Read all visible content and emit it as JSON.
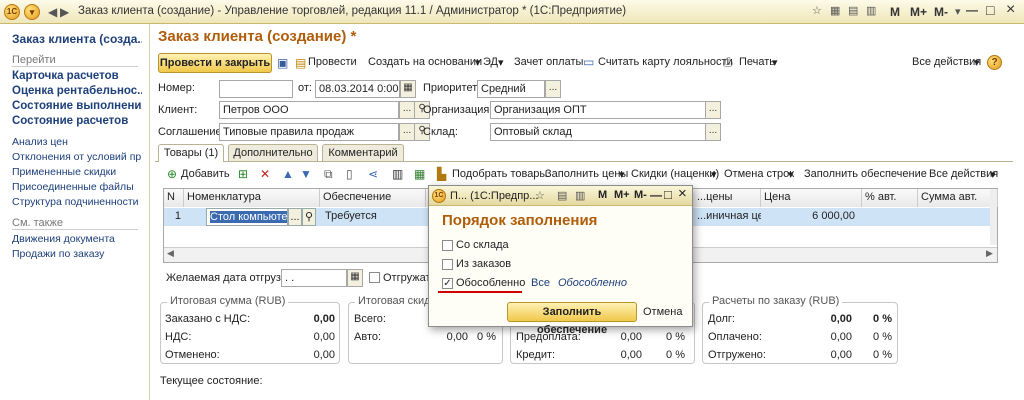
{
  "window": {
    "title": "Заказ клиента (создание) - Управление торговлей, редакция 11.1 / Администратор * (1С:Предприятие)",
    "logo": "1С",
    "minimize_glyph": "—",
    "maximize_glyph": "□",
    "close_glyph": "×"
  },
  "sidebar": {
    "top_item": "Заказ клиента (созда...",
    "goto_header": "Перейти",
    "bold_items": [
      "Карточка расчетов",
      "Оценка рентабельнос...",
      "Состояние выполнения",
      "Состояние расчетов"
    ],
    "items": [
      "Анализ цен",
      "Отклонения от условий пр...",
      "Примененные скидки",
      "Присоединенные файлы",
      "Структура подчиненности"
    ],
    "see_also_header": "См. также",
    "see_also": [
      "Движения документа",
      "Продажи по заказу"
    ]
  },
  "form": {
    "title": "Заказ клиента (создание) *",
    "toolbar": {
      "post_close": "Провести и закрыть",
      "post": "Провести",
      "create_based": "Создать на основании",
      "ed": "ЭД",
      "offset_payment": "Зачет оплаты",
      "loyalty": "Считать карту лояльности",
      "print": "Печать",
      "all_actions": "Все действия",
      "help": "?"
    },
    "fields": {
      "number_label": "Номер:",
      "number": "",
      "date_label": "от:",
      "date": "08.03.2014  0:00:00",
      "priority_label": "Приоритет:",
      "priority": "Средний",
      "client_label": "Клиент:",
      "client": "Петров ООО",
      "org_label": "Организация:",
      "org": "Организация ОПТ",
      "agreement_label": "Соглашение:",
      "agreement": "Типовые правила продаж",
      "warehouse_label": "Склад:",
      "warehouse": "Оптовый склад"
    },
    "tabs": [
      "Товары (1)",
      "Дополнительно",
      "Комментарий"
    ],
    "goods_toolbar": {
      "add": "Добавить",
      "pick": "Подобрать товары",
      "fill_prices": "Заполнить цены",
      "discounts": "Скидки (наценки)",
      "cancel_rows": "Отмена строк",
      "fill_supply": "Заполнить обеспечение",
      "all_actions": "Все действия"
    },
    "grid": {
      "columns": [
        "N",
        "Номенклатура",
        "Обеспечение",
        "...цены",
        "Цена",
        "% авт.",
        "Сумма авт."
      ],
      "row": {
        "n": "1",
        "item": "Стол компьютерн...",
        "supply": "Требуется",
        "price_type": "...иничная цена",
        "price": "6 000,00"
      }
    },
    "ship_date_label": "Желаемая дата отгрузки:",
    "ship_date": " .  .",
    "ship_check_label": "Отгружать",
    "totals": {
      "title": "Итоговая сумма (RUB)",
      "ordered_label": "Заказано с НДС:",
      "ordered": "0,00",
      "vat_label": "НДС:",
      "vat": "0,00",
      "cancelled_label": "Отменено:",
      "cancelled": "0,00"
    },
    "discounts": {
      "title": "Итоговая скидк...",
      "all_label": "Всего:",
      "all": "0,00",
      "all_pct": "0 %",
      "auto_label": "Авто:",
      "auto": "0,00",
      "auto_pct": "0 %"
    },
    "payments": {
      "prepay_label": "Предоплата:",
      "prepay": "0,00",
      "prepay_pct": "0 %",
      "credit_label": "Кредит:",
      "credit": "0,00",
      "credit_pct": "0 %"
    },
    "settlements": {
      "title": "Расчеты по заказу (RUB)",
      "debt_label": "Долг:",
      "debt": "0,00",
      "debt_pct": "0 %",
      "paid_label": "Оплачено:",
      "paid": "0,00",
      "paid_pct": "0 %",
      "shipped_label": "Отгружено:",
      "shipped": "0,00",
      "shipped_pct": "0 %"
    },
    "current_state_label": "Текущее состояние:"
  },
  "dialog": {
    "title": "П...   (1С:Предпр...",
    "heading": "Порядок заполнения",
    "options": [
      {
        "label": "Со склада",
        "checked": false
      },
      {
        "label": "Из заказов",
        "checked": false
      },
      {
        "label": "Обособленно",
        "checked": true
      }
    ],
    "link_all": "Все",
    "link_separate": "Обособленно",
    "fill_button": "Заполнить обеспечение",
    "cancel": "Отмена",
    "check_glyph": "✓"
  },
  "colors": {
    "accent": "#b05d0a",
    "link": "#1d3f7a",
    "selection": "#cfe3f7",
    "underline_red": "#d00000"
  }
}
